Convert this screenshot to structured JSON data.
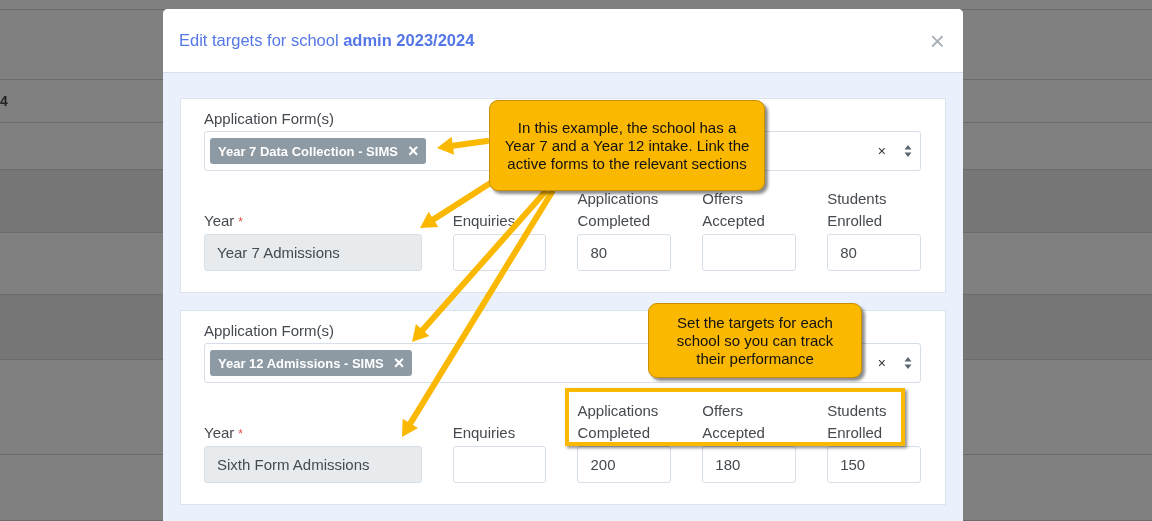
{
  "background": {
    "cell": "4"
  },
  "modal": {
    "title": "Edit targets for school **admin 2023/2024**",
    "close": "×"
  },
  "sections": [
    {
      "forms_label": "Application Form(s)",
      "tags": [
        {
          "label": "Year 7 Data Collection - SIMS",
          "remove": "×"
        }
      ],
      "clear": "×",
      "fields": [
        {
          "kind": "year",
          "label": "Year",
          "required_mark": "*",
          "value": "Year 7 Admissions"
        },
        {
          "kind": "number",
          "label": "Enquiries"
        },
        {
          "kind": "number",
          "label": "Applications Completed",
          "value": "80"
        },
        {
          "kind": "number",
          "label": "Offers Accepted"
        },
        {
          "kind": "number",
          "label": "Students Enrolled",
          "value": "80"
        }
      ]
    },
    {
      "forms_label": "Application Form(s)",
      "tags": [
        {
          "label": "Year 12 Admissions - SIMS",
          "remove": "×"
        }
      ],
      "clear": "×",
      "fields": [
        {
          "kind": "year",
          "label": "Year",
          "required_mark": "*",
          "value": "Sixth Form Admissions"
        },
        {
          "kind": "number",
          "label": "Enquiries"
        },
        {
          "kind": "number",
          "label": "Applications Completed",
          "value": "200"
        },
        {
          "kind": "number",
          "label": "Offers Accepted",
          "value": "180"
        },
        {
          "kind": "number",
          "label": "Students Enrolled",
          "value": "150"
        }
      ]
    }
  ],
  "callouts": [
    {
      "text": "In this example, the school has a Year 7 and a Year 12 intake. Link the active forms to the relevant sections"
    },
    {
      "text": "Set the targets for each school so you can track their performance"
    }
  ]
}
